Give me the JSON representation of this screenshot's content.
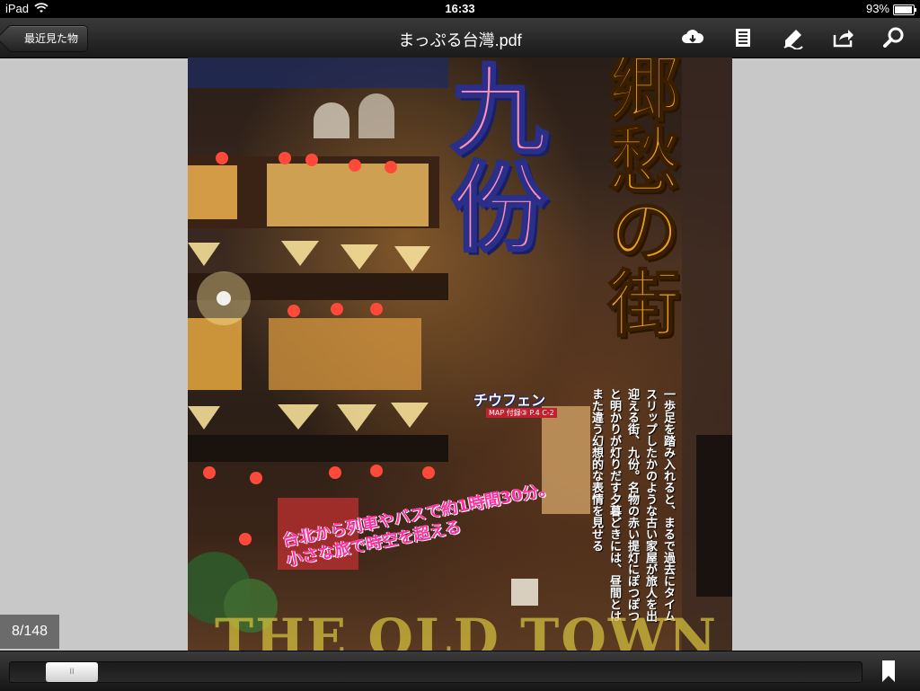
{
  "status_bar": {
    "device": "iPad",
    "time": "16:33",
    "battery_percent": "93%",
    "battery_level": 0.93
  },
  "toolbar": {
    "back_label": "最近見た物",
    "title": "まっぷる台灣.pdf",
    "icons": [
      "cloud-download-icon",
      "table-of-contents-icon",
      "annotate-icon",
      "share-icon",
      "search-icon"
    ]
  },
  "page_content": {
    "big_title": "九份",
    "sub_title": "郷愁の街",
    "reading": "チウフェン",
    "map_ref": "MAP 付録③ P.4 C-2",
    "body_text": "一歩足を踏み入れると、まるで過去にタイムスリップしたかのような古い家屋が旅人を出迎える街、九份。名物の赤い提灯にぽつぽつと明かりが灯りだす夕暮どきには、昼間とはまた違う幻想的な表情を見せる",
    "tagline_line1": "台北から列車やバスで約1時間30分。",
    "tagline_line2": "小さな旅で時空を超える",
    "watermark": "THE OLD TOWN"
  },
  "page_indicator": "8/148",
  "scrubber": {
    "current_page": 8,
    "total_pages": 148,
    "thumb_glyph": "II"
  },
  "colors": {
    "toolbar": "#2a2a2a",
    "background": "#c8c8c8",
    "title_pink": "#ff8fb4",
    "title_outline": "#2a2f8a",
    "subtitle_gold": "#e9a020",
    "tagline_magenta": "#ff2ea0"
  }
}
